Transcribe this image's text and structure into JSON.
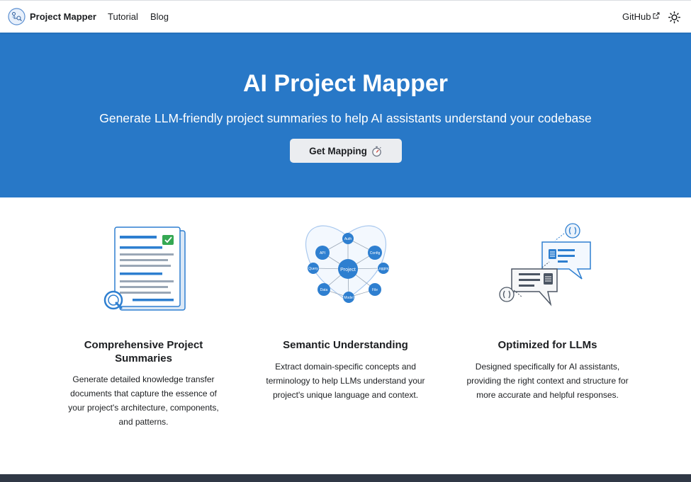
{
  "nav": {
    "brand": "Project Mapper",
    "links": [
      "Tutorial",
      "Blog"
    ],
    "github": "GitHub"
  },
  "hero": {
    "title": "AI Project Mapper",
    "subtitle": "Generate LLM-friendly project summaries to help AI assistants understand your codebase",
    "cta": "Get Mapping",
    "background": "#2878c7"
  },
  "features": [
    {
      "title": "Comprehensive Project Summaries",
      "description": "Generate detailed knowledge transfer documents that capture the essence of your project's architecture, components, and patterns.",
      "icon": "document-magnifier-icon"
    },
    {
      "title": "Semantic Understanding",
      "description": "Extract domain-specific concepts and terminology to help LLMs understand your project's unique language and context.",
      "icon": "knowledge-graph-icon",
      "graph_labels": {
        "center": "Project",
        "nodes": [
          "Auth",
          "Config",
          "Logging",
          "File",
          "Model",
          "Data",
          "Query",
          "API"
        ]
      }
    },
    {
      "title": "Optimized for LLMs",
      "description": "Designed specifically for AI assistants, providing the right context and structure for more accurate and helpful responses.",
      "icon": "chat-bubbles-icon"
    }
  ]
}
